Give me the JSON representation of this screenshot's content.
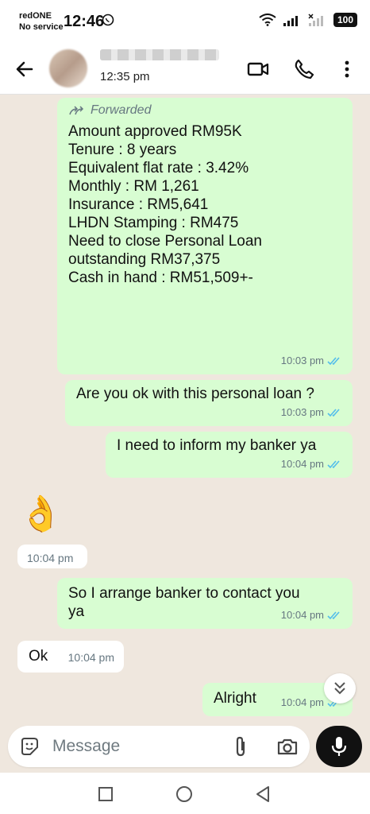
{
  "status_bar": {
    "carrier": "redONE",
    "network_status": "No service",
    "time": "12:46",
    "battery": "100"
  },
  "header": {
    "last_seen": "12:35 pm"
  },
  "messages": [
    {
      "type": "outgoing",
      "forwarded": "Forwarded",
      "lines": [
        "Amount approved RM95K",
        "Tenure : 8 years",
        "Equivalent flat rate : 3.42%",
        "Monthly : RM 1,261",
        "",
        "Insurance : RM5,641",
        "LHDN Stamping : RM475",
        "",
        "Need to close Personal Loan",
        "outstanding RM37,375",
        "",
        "Cash in hand : RM51,509+-"
      ],
      "time": "10:03 pm"
    },
    {
      "type": "outgoing",
      "text": "Are you ok with this personal loan ?",
      "time": "10:03 pm"
    },
    {
      "type": "outgoing",
      "text": "I need to inform my banker ya",
      "time": "10:04 pm"
    },
    {
      "type": "incoming",
      "emoji": "👌",
      "time": "10:04 pm"
    },
    {
      "type": "outgoing",
      "lines": [
        "So I arrange banker to contact you",
        "ya"
      ],
      "time": "10:04 pm"
    },
    {
      "type": "incoming",
      "text": "Ok",
      "time": "10:04 pm"
    },
    {
      "type": "outgoing",
      "text": "Alright",
      "time": "10:04 pm"
    }
  ],
  "input": {
    "placeholder": "Message"
  },
  "icons": {
    "read_ticks_color": "#53bdeb",
    "accent": "#111111"
  }
}
